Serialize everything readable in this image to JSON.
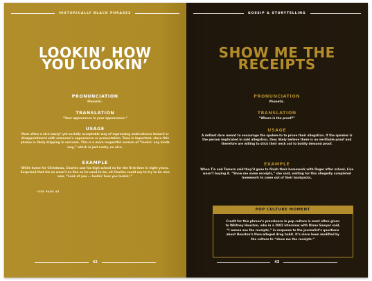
{
  "left_page": {
    "header": "HISTORICALLY BLACK PHRASES",
    "title_line1": "LOOKIN’ HOW",
    "title_line2": "YOU LOOKIN’",
    "pronunciation_head": "PRONUNCIATION",
    "pronunciation_text": "Phonetic.",
    "translation_head": "TRANSLATION",
    "translation_text": "“Your appearance is your appearance.”",
    "usage_head": "USAGE",
    "usage_text": "Most often a nice-nasty* yet socially acceptable way of expressing ambivalence toward or disappointment with someone’s appearance or presentation. Tone is important, since this phrase is likely dripping in sarcasm. This is a more respectful version of “lookin’ any kinda way,” which is just nasty, no nice.",
    "example_head": "EXAMPLE",
    "example_text": "While home for Christmas, Charles saw his high school ex for the first time in eight years. Surprised that his ex wasn’t as fine as he used to be, all Charles could say to try to be nice was, “Look at you … lookin’ how you lookin’.”",
    "see_page": "*SEE PAGE 45",
    "page_number": "42"
  },
  "right_page": {
    "header": "GOSSIP & STORYTELLING",
    "title_line1": "SHOW ME THE",
    "title_line2": "RECEIPTS",
    "pronunciation_head": "PRONUNCIATION",
    "pronunciation_text": "Phonetic.",
    "translation_head": "TRANSLATION",
    "translation_text": "“Where is the proof?”",
    "usage_head": "USAGE",
    "usage_text": "A defiant dare meant to encourage the spoken-to to prove their allegation. If the speaker is the person implicated in said allegation, they likely believe there is no verifiable proof and therefore are willing to stick their neck out to boldly demand proof.",
    "example_head": "EXAMPLE",
    "example_text": "When Tia and Tamera said they’d gone to finish their homework with Roger after school, Lisa wasn’t buying it. “Show me some receipts,” she said, waiting for this allegedly completed homework to come out of their backpacks.",
    "callout_head": "POP CULTURE MOMENT",
    "callout_text": "Credit for this phrase’s prevalence in pop culture is most often given to Whitney Houston, who in a 2002 interview with Diane Sawyer said, “I wanna see the receipts,” in response to the journalist’s questions about Houston’s then-alleged drug habit. It’s since been modified by the culture to “show me the receipts.”",
    "page_number": "43"
  }
}
